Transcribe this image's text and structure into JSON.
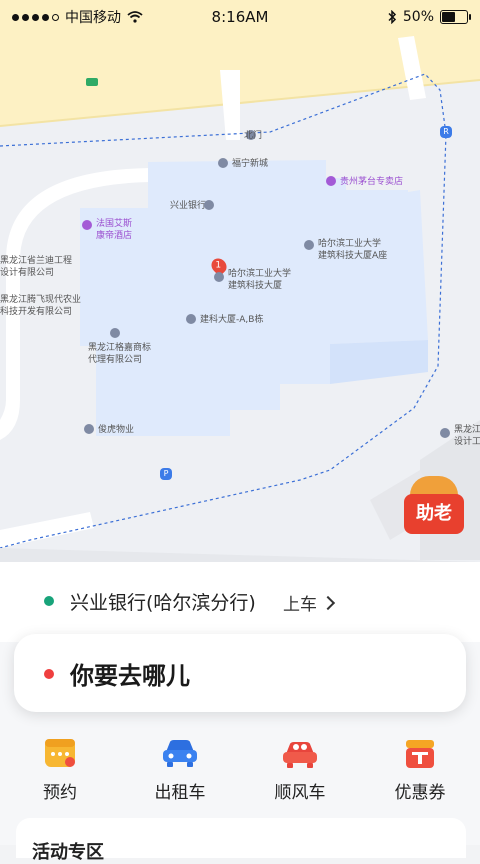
{
  "status_bar": {
    "carrier": "中国移动",
    "time": "8:16AM",
    "battery": "50%",
    "battery_level": 0.5
  },
  "map": {
    "pois": [
      {
        "id": "beimen",
        "text": "北门"
      },
      {
        "id": "funing",
        "text": "福宁新城"
      },
      {
        "id": "maotai",
        "text": "贵州茅台专卖店"
      },
      {
        "id": "xingye",
        "text": "兴业银行"
      },
      {
        "id": "faguo",
        "text": "法国艾斯\n康帝酒店"
      },
      {
        "id": "harbin_main",
        "text": "哈尔滨工业大学\n建筑科技大厦"
      },
      {
        "id": "harbin_a",
        "text": "哈尔滨工业大学\n建筑科技大厦A座"
      },
      {
        "id": "jianke",
        "text": "建科大厦-A,B栋"
      },
      {
        "id": "lanmu",
        "text": "黑龙江省兰迪工程\n设计有限公司"
      },
      {
        "id": "tengfei",
        "text": "黑龙江腾飞现代农业\n科技开发有限公司"
      },
      {
        "id": "gejia",
        "text": "黑龙江格嘉商标\n代理有限公司"
      },
      {
        "id": "junhu",
        "text": "俊虎物业"
      },
      {
        "id": "right_edge",
        "text": "黑龙江省\n设计工程"
      }
    ],
    "selected_pin_number": "1",
    "parking_symbol": "P",
    "bus_symbol": "R",
    "helper_badge": "助老",
    "colors": {
      "road": "#fdf1c4",
      "campus": "#dfeafc",
      "boundary": "#3b6fd6",
      "background": "#eef0f4"
    }
  },
  "pickup": {
    "place": "兴业银行(哈尔滨分行)",
    "action": "上车",
    "dot_color": "#18a37a"
  },
  "destination": {
    "prompt": "你要去哪儿",
    "dot_color": "#ef3f3f"
  },
  "services": [
    {
      "label": "预约",
      "icon": "calendar-icon"
    },
    {
      "label": "出租车",
      "icon": "taxi-icon"
    },
    {
      "label": "顺风车",
      "icon": "carpool-icon"
    },
    {
      "label": "优惠券",
      "icon": "coupon-icon"
    }
  ],
  "activity": {
    "title": "活动专区"
  }
}
